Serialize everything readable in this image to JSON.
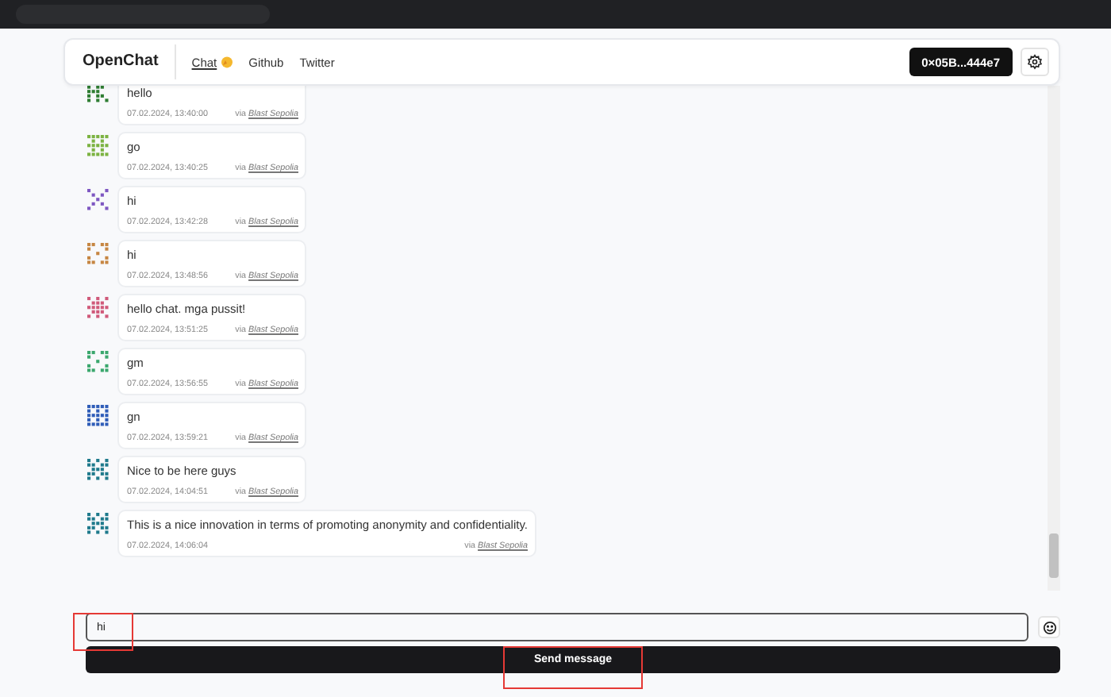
{
  "header": {
    "brand": "OpenChat",
    "tabs": [
      {
        "label": "Chat",
        "selected": true
      },
      {
        "label": "Github",
        "selected": false
      },
      {
        "label": "Twitter",
        "selected": false
      }
    ],
    "wallet": "0×05B...444e7"
  },
  "messages": [
    {
      "text": "hello",
      "time": "07.02.2024, 13:40:00",
      "via": "via",
      "network": "Blast Sepolia",
      "color": "#2e7d32"
    },
    {
      "text": "go",
      "time": "07.02.2024, 13:40:25",
      "via": "via",
      "network": "Blast Sepolia",
      "color": "#7cb342"
    },
    {
      "text": "hi",
      "time": "07.02.2024, 13:42:28",
      "via": "via",
      "network": "Blast Sepolia",
      "color": "#7e57c2"
    },
    {
      "text": "hi",
      "time": "07.02.2024, 13:48:56",
      "via": "via",
      "network": "Blast Sepolia",
      "color": "#c68642"
    },
    {
      "text": "hello chat. mga pussit!",
      "time": "07.02.2024, 13:51:25",
      "via": "via",
      "network": "Blast Sepolia",
      "color": "#d05a7a"
    },
    {
      "text": "gm",
      "time": "07.02.2024, 13:56:55",
      "via": "via",
      "network": "Blast Sepolia",
      "color": "#3aa76d"
    },
    {
      "text": "gn",
      "time": "07.02.2024, 13:59:21",
      "via": "via",
      "network": "Blast Sepolia",
      "color": "#2f5db8"
    },
    {
      "text": "Nice to be here guys",
      "time": "07.02.2024, 14:04:51",
      "via": "via",
      "network": "Blast Sepolia",
      "color": "#1f7a8c"
    },
    {
      "text": "This is a nice innovation in terms of promoting anonymity and confidentiality.",
      "time": "07.02.2024, 14:06:04",
      "via": "via",
      "network": "Blast Sepolia",
      "color": "#1f7a8c"
    }
  ],
  "composer": {
    "value": "hi",
    "send": "Send message"
  }
}
